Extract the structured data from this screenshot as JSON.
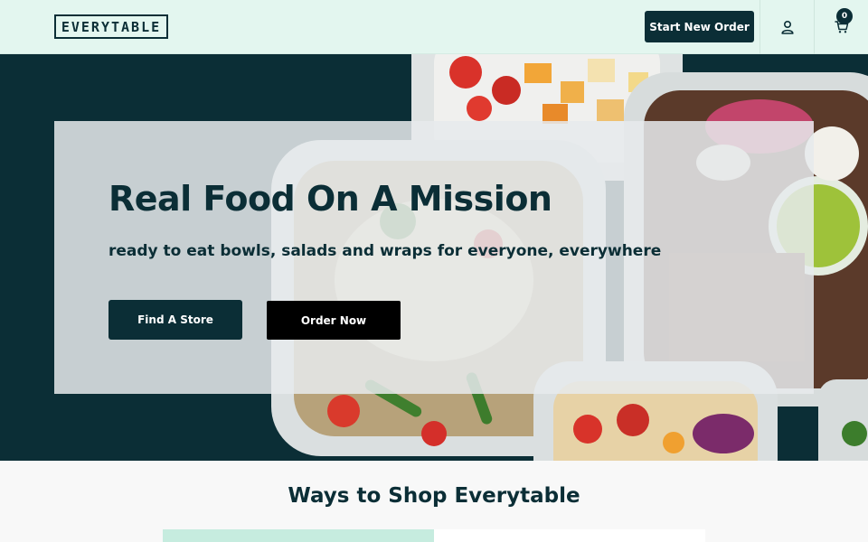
{
  "header": {
    "logo_text": "EVERYTABLE",
    "start_order_label": "Start New Order",
    "account_icon": "user-icon",
    "cart_icon": "cart-icon",
    "cart_count": "0"
  },
  "hero": {
    "title": "Real Food On A Mission",
    "subtitle": "ready to eat bowls, salads and wraps for everyone, everywhere",
    "find_store_label": "Find A Store",
    "order_now_label": "Order Now",
    "image_description_icon": "food-bowls-photo"
  },
  "ways": {
    "title": "Ways to Shop Everytable"
  },
  "colors": {
    "brand_dark": "#0b2e36",
    "header_bg": "#e3f6ef",
    "order_button": "#000000"
  }
}
